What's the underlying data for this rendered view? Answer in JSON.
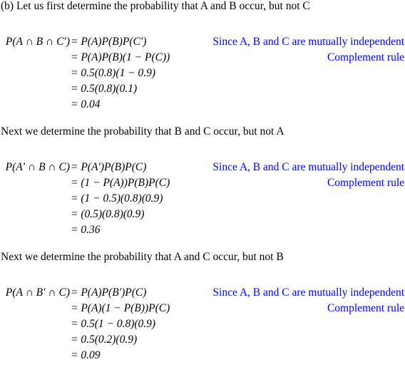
{
  "accent_color": "#0000ff",
  "sections": [
    {
      "intro": "(b) Let us first determine the probability that A and B occur, but not C",
      "lhs": "P(A ∩ B ∩ C′)",
      "lines": [
        {
          "rhs": "= P(A)P(B)P(C′)",
          "note": "Since A, B and C are mutually independent"
        },
        {
          "rhs": "= P(A)P(B)(1 − P(C))",
          "note": "Complement rule"
        },
        {
          "rhs": "= 0.5(0.8)(1 − 0.9)",
          "note": ""
        },
        {
          "rhs": "= 0.5(0.8)(0.1)",
          "note": ""
        },
        {
          "rhs": "= 0.04",
          "note": ""
        }
      ]
    },
    {
      "intro": "Next we determine the probability that B and C occur, but not A",
      "lhs": "P(A′ ∩ B ∩ C)",
      "lines": [
        {
          "rhs": "= P(A′)P(B)P(C)",
          "note": "Since A, B and C are mutually independent"
        },
        {
          "rhs": "= (1 − P(A))P(B)P(C)",
          "note": "Complement rule"
        },
        {
          "rhs": "= (1 − 0.5)(0.8)(0.9)",
          "note": ""
        },
        {
          "rhs": "= (0.5)(0.8)(0.9)",
          "note": ""
        },
        {
          "rhs": "= 0.36",
          "note": ""
        }
      ]
    },
    {
      "intro": "Next we determine the probability that A and C occur, but not B",
      "lhs": "P(A ∩ B′ ∩ C)",
      "lines": [
        {
          "rhs": "= P(A)P(B′)P(C)",
          "note": "Since A, B and C are mutually independent"
        },
        {
          "rhs": "= P(A)(1 − P(B))P(C)",
          "note": "Complement rule"
        },
        {
          "rhs": "= 0.5(1 − 0.8)(0.9)",
          "note": ""
        },
        {
          "rhs": "= 0.5(0.2)(0.9)",
          "note": ""
        },
        {
          "rhs": "= 0.09",
          "note": ""
        }
      ]
    }
  ]
}
